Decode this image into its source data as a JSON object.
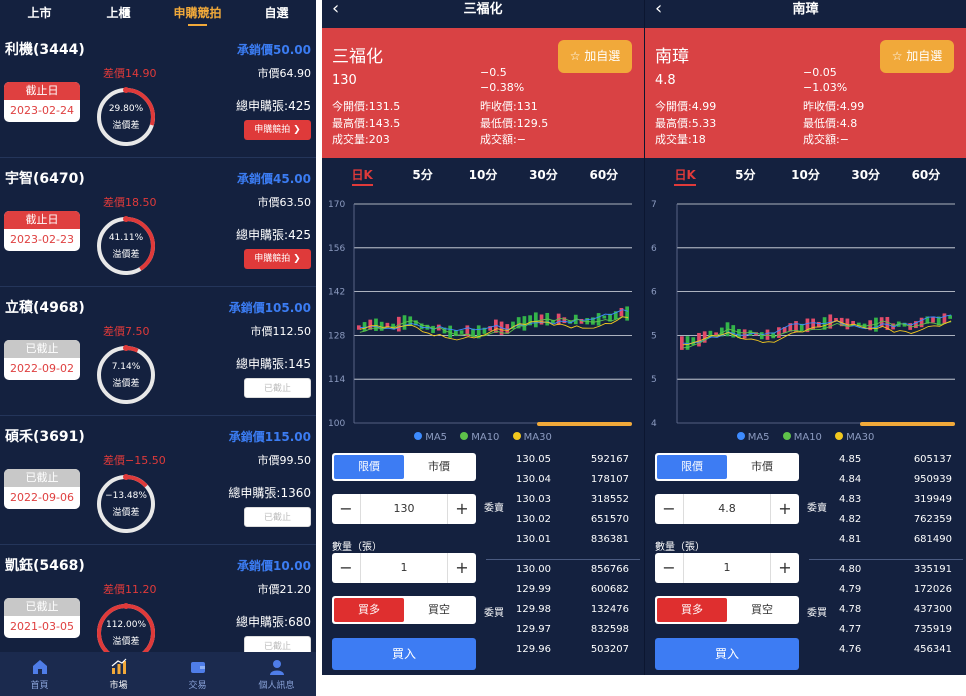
{
  "panel1": {
    "tabs": [
      "上市",
      "上櫃",
      "申購競拍",
      "自選"
    ],
    "active_tab": 2,
    "cards": [
      {
        "name": "利機(3444)",
        "diff": "差價14.90",
        "underwrite": "承銷價50.00",
        "market": "市價64.90",
        "date_head": "截止日",
        "date": "2023-02-24",
        "pct": "29.80%",
        "pct_value": 29.8,
        "premium": "溢價差",
        "sheets": "總申購張:425",
        "btn": "申購競拍 ❯",
        "active": true
      },
      {
        "name": "宇智(6470)",
        "diff": "差價18.50",
        "underwrite": "承銷價45.00",
        "market": "市價63.50",
        "date_head": "截止日",
        "date": "2023-02-23",
        "pct": "41.11%",
        "pct_value": 41.11,
        "premium": "溢價差",
        "sheets": "總申購張:425",
        "btn": "申購競拍 ❯",
        "active": true
      },
      {
        "name": "立積(4968)",
        "diff": "差價7.50",
        "underwrite": "承銷價105.00",
        "market": "市價112.50",
        "date_head": "已截止",
        "date": "2022-09-02",
        "pct": "7.14%",
        "pct_value": 7.14,
        "premium": "溢價差",
        "sheets": "總申購張:145",
        "btn": "已截止",
        "active": false
      },
      {
        "name": "碩禾(3691)",
        "diff": "差價−15.50",
        "underwrite": "承銷價115.00",
        "market": "市價99.50",
        "date_head": "已截止",
        "date": "2022-09-06",
        "pct": "−13.48%",
        "pct_value": -13.48,
        "premium": "溢價差",
        "sheets": "總申購張:1360",
        "btn": "已截止",
        "active": false
      },
      {
        "name": "凱鈺(5468)",
        "diff": "差價11.20",
        "underwrite": "承銷價10.00",
        "market": "市價21.20",
        "date_head": "已截止",
        "date": "2021-03-05",
        "pct": "112.00%",
        "pct_value": 112.0,
        "premium": "溢價差",
        "sheets": "總申購張:680",
        "btn": "已截止",
        "active": false
      }
    ],
    "nav": [
      {
        "label": "首頁",
        "icon": "home-icon"
      },
      {
        "label": "市場",
        "icon": "chart-icon"
      },
      {
        "label": "交易",
        "icon": "wallet-icon"
      },
      {
        "label": "個人訊息",
        "icon": "user-icon"
      }
    ],
    "active_nav": 1
  },
  "panel2": {
    "title": "三福化",
    "name": "三福化",
    "price": "130",
    "chg": "−0.5",
    "chg_pct": "−0.38%",
    "open": "今開價:131.5",
    "prev": "昨收價:131",
    "high": "最高價:143.5",
    "low": "最低價:129.5",
    "vol": "成交量:203",
    "amount": "成交額:−",
    "fav": "☆ 加自選",
    "periods": [
      "日K",
      "5分",
      "10分",
      "30分",
      "60分"
    ],
    "order_types": [
      "限價",
      "市價"
    ],
    "qty_label": "數量（張）",
    "price_input": "130",
    "qty_input": "1",
    "side": [
      "買多",
      "買空"
    ],
    "buy": "買入",
    "sell_label": "委賣",
    "buy_label": "委買",
    "asks": [
      [
        "130.05",
        "592167"
      ],
      [
        "130.04",
        "178107"
      ],
      [
        "130.03",
        "318552"
      ],
      [
        "130.02",
        "651570"
      ],
      [
        "130.01",
        "836381"
      ]
    ],
    "bids": [
      [
        "130.00",
        "856766"
      ],
      [
        "129.99",
        "600682"
      ],
      [
        "129.98",
        "132476"
      ],
      [
        "129.97",
        "832598"
      ],
      [
        "129.96",
        "503207"
      ]
    ],
    "chart": {
      "ticks": [
        "170",
        "156",
        "142",
        "128",
        "114",
        "100"
      ],
      "ylim": [
        100,
        170
      ]
    },
    "legend": [
      "MA5",
      "MA10",
      "MA30"
    ]
  },
  "panel3": {
    "title": "南璋",
    "name": "南璋",
    "price": "4.8",
    "chg": "−0.05",
    "chg_pct": "−1.03%",
    "open": "今開價:4.99",
    "prev": "昨收價:4.99",
    "high": "最高價:5.33",
    "low": "最低價:4.8",
    "vol": "成交量:18",
    "amount": "成交額:−",
    "fav": "☆ 加自選",
    "periods": [
      "日K",
      "5分",
      "10分",
      "30分",
      "60分"
    ],
    "order_types": [
      "限價",
      "市價"
    ],
    "qty_label": "數量（張）",
    "price_input": "4.8",
    "qty_input": "1",
    "side": [
      "買多",
      "買空"
    ],
    "buy": "買入",
    "sell_label": "委賣",
    "buy_label": "委買",
    "asks": [
      [
        "4.85",
        "605137"
      ],
      [
        "4.84",
        "950939"
      ],
      [
        "4.83",
        "319949"
      ],
      [
        "4.82",
        "762359"
      ],
      [
        "4.81",
        "681490"
      ]
    ],
    "bids": [
      [
        "4.80",
        "335191"
      ],
      [
        "4.79",
        "172026"
      ],
      [
        "4.78",
        "437300"
      ],
      [
        "4.77",
        "735919"
      ],
      [
        "4.76",
        "456341"
      ]
    ],
    "chart": {
      "ticks": [
        "7",
        "6",
        "6",
        "5",
        "5",
        "4"
      ],
      "ylim": [
        4,
        7
      ]
    },
    "legend": [
      "MA5",
      "MA10",
      "MA30"
    ]
  },
  "colors": {
    "bg": "#14213f",
    "red": "#d94244",
    "accent": "#f1a93a",
    "blue": "#3d7cf3",
    "ma5": "#3d8bff",
    "ma10": "#5ec24a",
    "ma30": "#f2c81e",
    "up": "#e24b6a",
    "down": "#33b44a"
  }
}
